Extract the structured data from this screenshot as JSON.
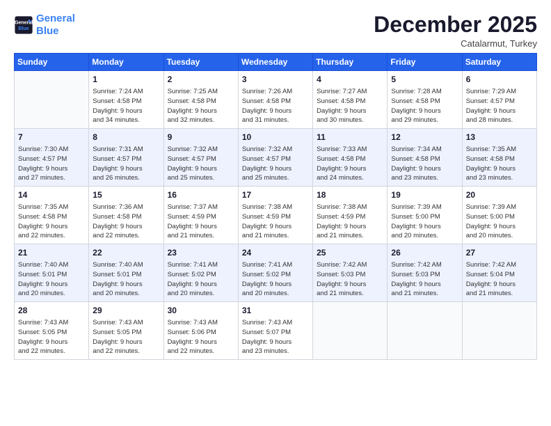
{
  "header": {
    "logo_line1": "General",
    "logo_line2": "Blue",
    "month": "December 2025",
    "location": "Catalarmut, Turkey"
  },
  "weekdays": [
    "Sunday",
    "Monday",
    "Tuesday",
    "Wednesday",
    "Thursday",
    "Friday",
    "Saturday"
  ],
  "weeks": [
    [
      {
        "day": "",
        "text": ""
      },
      {
        "day": "1",
        "text": "Sunrise: 7:24 AM\nSunset: 4:58 PM\nDaylight: 9 hours\nand 34 minutes."
      },
      {
        "day": "2",
        "text": "Sunrise: 7:25 AM\nSunset: 4:58 PM\nDaylight: 9 hours\nand 32 minutes."
      },
      {
        "day": "3",
        "text": "Sunrise: 7:26 AM\nSunset: 4:58 PM\nDaylight: 9 hours\nand 31 minutes."
      },
      {
        "day": "4",
        "text": "Sunrise: 7:27 AM\nSunset: 4:58 PM\nDaylight: 9 hours\nand 30 minutes."
      },
      {
        "day": "5",
        "text": "Sunrise: 7:28 AM\nSunset: 4:58 PM\nDaylight: 9 hours\nand 29 minutes."
      },
      {
        "day": "6",
        "text": "Sunrise: 7:29 AM\nSunset: 4:57 PM\nDaylight: 9 hours\nand 28 minutes."
      }
    ],
    [
      {
        "day": "7",
        "text": "Sunrise: 7:30 AM\nSunset: 4:57 PM\nDaylight: 9 hours\nand 27 minutes."
      },
      {
        "day": "8",
        "text": "Sunrise: 7:31 AM\nSunset: 4:57 PM\nDaylight: 9 hours\nand 26 minutes."
      },
      {
        "day": "9",
        "text": "Sunrise: 7:32 AM\nSunset: 4:57 PM\nDaylight: 9 hours\nand 25 minutes."
      },
      {
        "day": "10",
        "text": "Sunrise: 7:32 AM\nSunset: 4:57 PM\nDaylight: 9 hours\nand 25 minutes."
      },
      {
        "day": "11",
        "text": "Sunrise: 7:33 AM\nSunset: 4:58 PM\nDaylight: 9 hours\nand 24 minutes."
      },
      {
        "day": "12",
        "text": "Sunrise: 7:34 AM\nSunset: 4:58 PM\nDaylight: 9 hours\nand 23 minutes."
      },
      {
        "day": "13",
        "text": "Sunrise: 7:35 AM\nSunset: 4:58 PM\nDaylight: 9 hours\nand 23 minutes."
      }
    ],
    [
      {
        "day": "14",
        "text": "Sunrise: 7:35 AM\nSunset: 4:58 PM\nDaylight: 9 hours\nand 22 minutes."
      },
      {
        "day": "15",
        "text": "Sunrise: 7:36 AM\nSunset: 4:58 PM\nDaylight: 9 hours\nand 22 minutes."
      },
      {
        "day": "16",
        "text": "Sunrise: 7:37 AM\nSunset: 4:59 PM\nDaylight: 9 hours\nand 21 minutes."
      },
      {
        "day": "17",
        "text": "Sunrise: 7:38 AM\nSunset: 4:59 PM\nDaylight: 9 hours\nand 21 minutes."
      },
      {
        "day": "18",
        "text": "Sunrise: 7:38 AM\nSunset: 4:59 PM\nDaylight: 9 hours\nand 21 minutes."
      },
      {
        "day": "19",
        "text": "Sunrise: 7:39 AM\nSunset: 5:00 PM\nDaylight: 9 hours\nand 20 minutes."
      },
      {
        "day": "20",
        "text": "Sunrise: 7:39 AM\nSunset: 5:00 PM\nDaylight: 9 hours\nand 20 minutes."
      }
    ],
    [
      {
        "day": "21",
        "text": "Sunrise: 7:40 AM\nSunset: 5:01 PM\nDaylight: 9 hours\nand 20 minutes."
      },
      {
        "day": "22",
        "text": "Sunrise: 7:40 AM\nSunset: 5:01 PM\nDaylight: 9 hours\nand 20 minutes."
      },
      {
        "day": "23",
        "text": "Sunrise: 7:41 AM\nSunset: 5:02 PM\nDaylight: 9 hours\nand 20 minutes."
      },
      {
        "day": "24",
        "text": "Sunrise: 7:41 AM\nSunset: 5:02 PM\nDaylight: 9 hours\nand 20 minutes."
      },
      {
        "day": "25",
        "text": "Sunrise: 7:42 AM\nSunset: 5:03 PM\nDaylight: 9 hours\nand 21 minutes."
      },
      {
        "day": "26",
        "text": "Sunrise: 7:42 AM\nSunset: 5:03 PM\nDaylight: 9 hours\nand 21 minutes."
      },
      {
        "day": "27",
        "text": "Sunrise: 7:42 AM\nSunset: 5:04 PM\nDaylight: 9 hours\nand 21 minutes."
      }
    ],
    [
      {
        "day": "28",
        "text": "Sunrise: 7:43 AM\nSunset: 5:05 PM\nDaylight: 9 hours\nand 22 minutes."
      },
      {
        "day": "29",
        "text": "Sunrise: 7:43 AM\nSunset: 5:05 PM\nDaylight: 9 hours\nand 22 minutes."
      },
      {
        "day": "30",
        "text": "Sunrise: 7:43 AM\nSunset: 5:06 PM\nDaylight: 9 hours\nand 22 minutes."
      },
      {
        "day": "31",
        "text": "Sunrise: 7:43 AM\nSunset: 5:07 PM\nDaylight: 9 hours\nand 23 minutes."
      },
      {
        "day": "",
        "text": ""
      },
      {
        "day": "",
        "text": ""
      },
      {
        "day": "",
        "text": ""
      }
    ]
  ]
}
